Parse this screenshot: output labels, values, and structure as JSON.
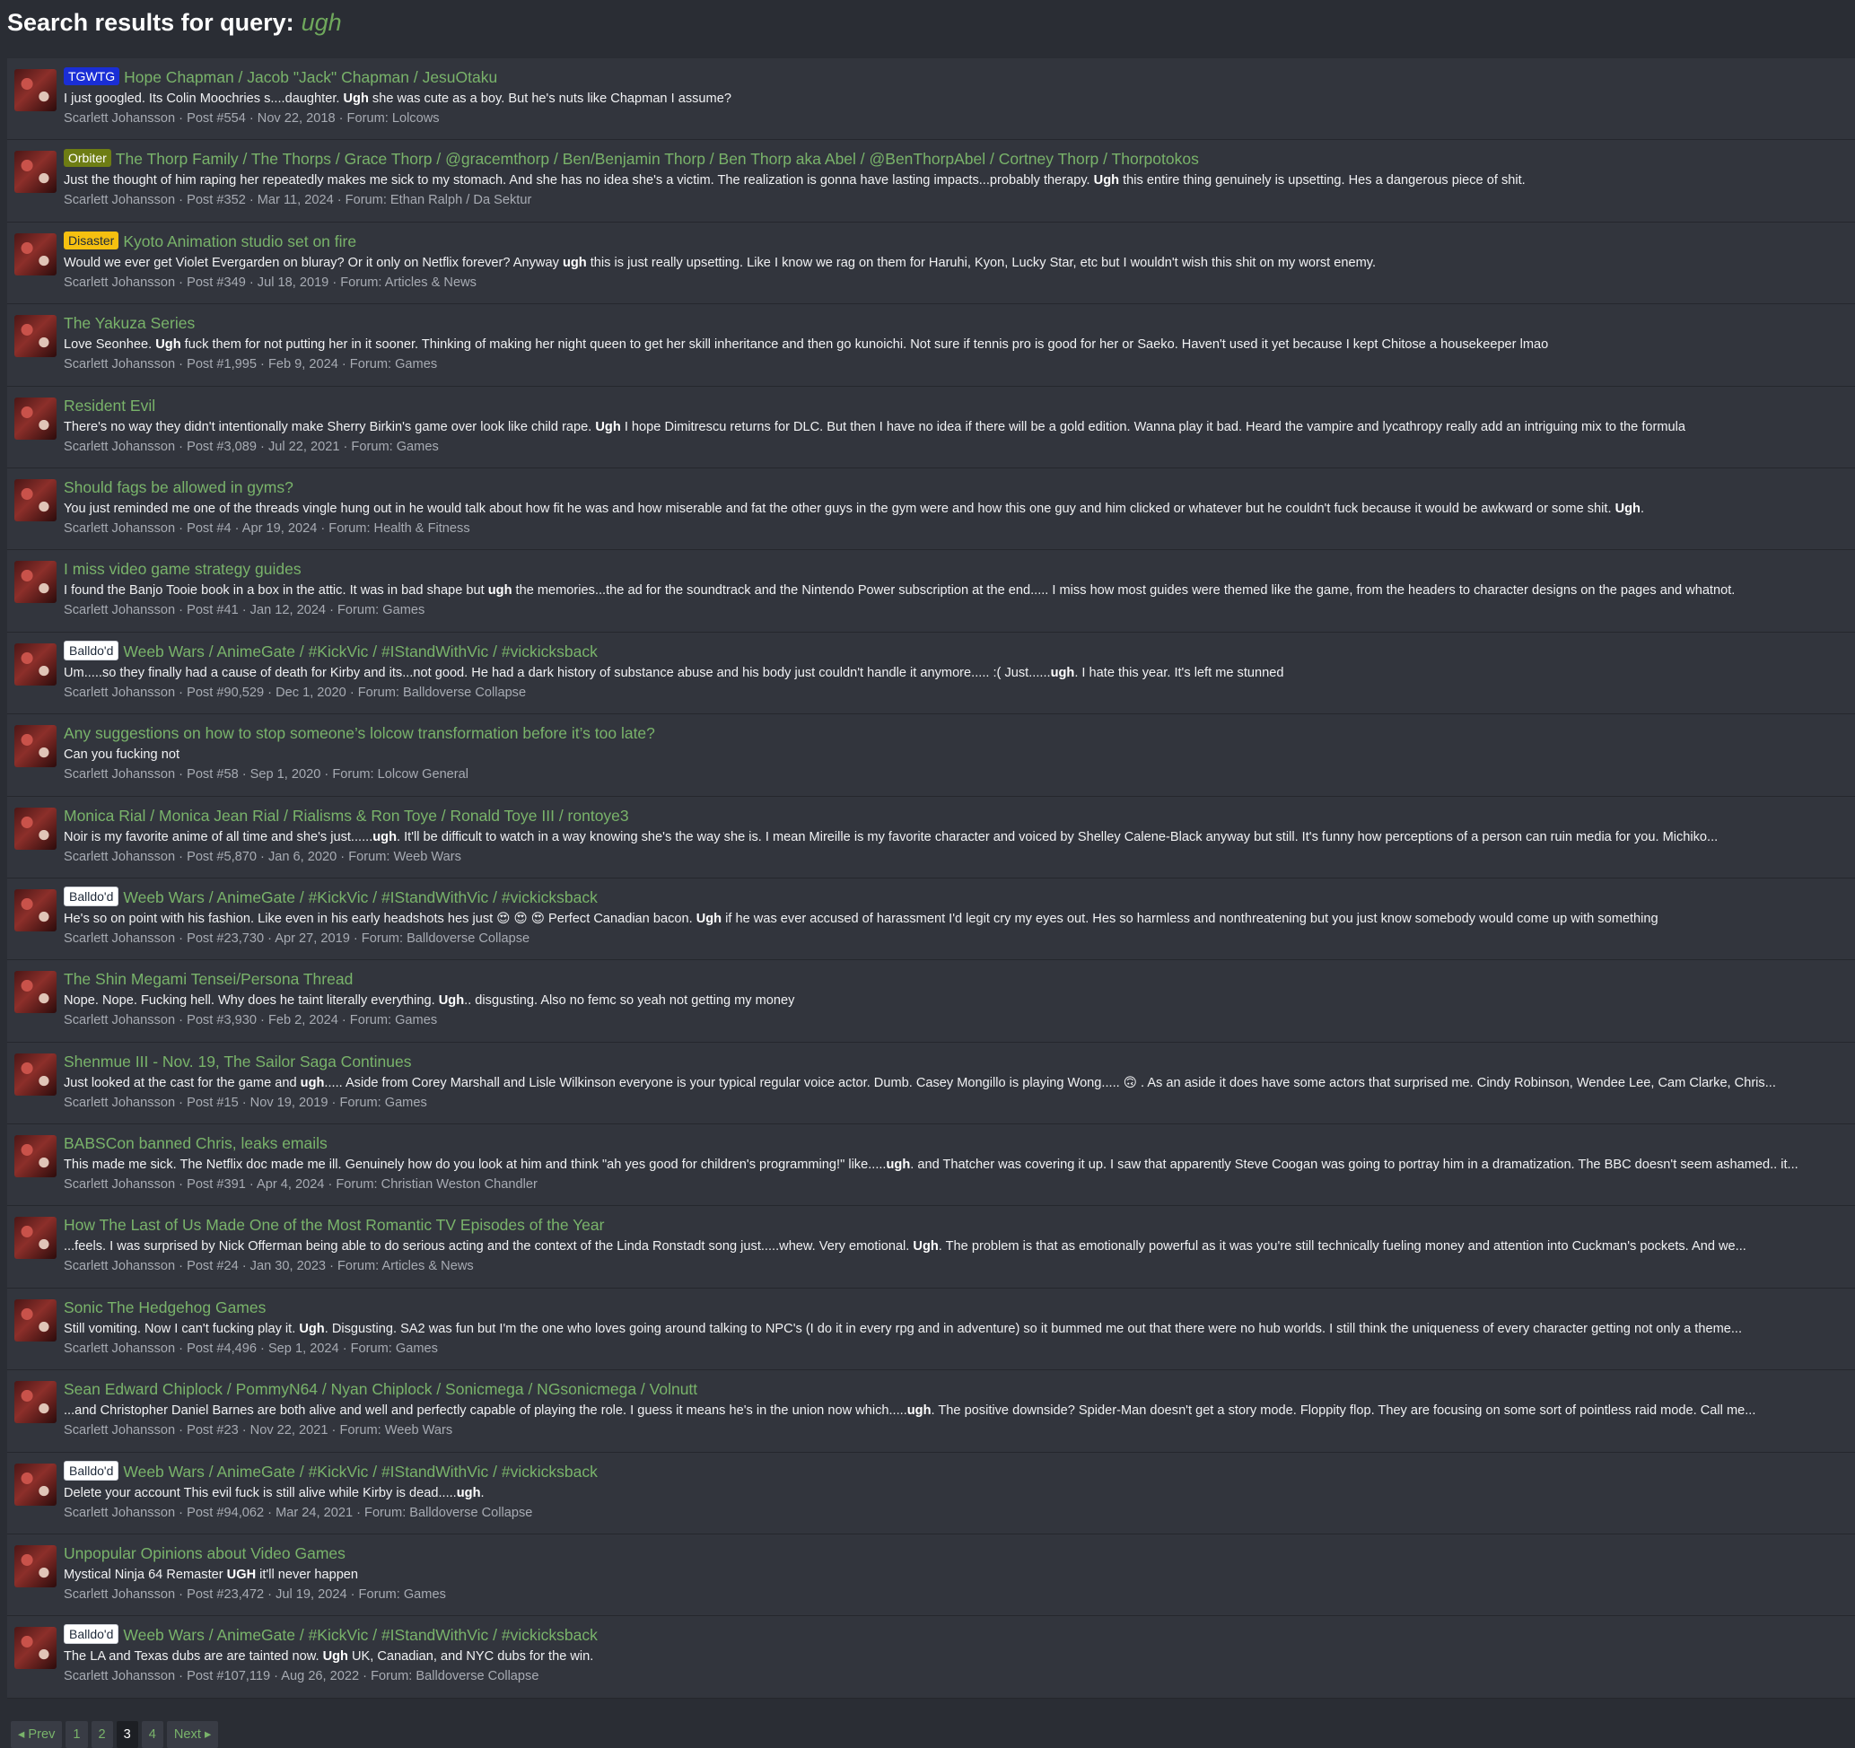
{
  "header": {
    "prefix": "Search results for query:",
    "query": "ugh"
  },
  "results": [
    {
      "label": "TGWTG",
      "label_color": "blue",
      "title": "Hope Chapman / Jacob \"Jack\" Chapman / JesuOtaku",
      "before": "I just googled. Its Colin Moochries s....daughter. ",
      "match": "Ugh",
      "after": " she was cute as a boy. But he's nuts like Chapman I assume?",
      "meta": "Scarlett Johansson · Post #554 · Nov 22, 2018 · Forum: Lolcows"
    },
    {
      "label": "Orbiter",
      "label_color": "olive",
      "title": "The Thorp Family / The Thorps / Grace Thorp / @gracemthorp / Ben/Benjamin Thorp / Ben Thorp aka Abel / @BenThorpAbel / Cortney Thorp / Thorpotokos",
      "before": "Just the thought of him raping her repeatedly makes me sick to my stomach. And she has no idea she's a victim. The realization is gonna have lasting impacts...probably therapy. ",
      "match": "Ugh",
      "after": " this entire thing genuinely is upsetting. Hes a dangerous piece of shit.",
      "meta": "Scarlett Johansson · Post #352 · Mar 11, 2024 · Forum: Ethan Ralph / Da Sektur"
    },
    {
      "label": "Disaster",
      "label_color": "yellow",
      "title": "Kyoto Animation studio set on fire",
      "before": "Would we ever get Violet Evergarden on bluray? Or it only on Netflix forever? Anyway ",
      "match": "ugh",
      "after": " this is just really upsetting. Like I know we rag on them for Haruhi, Kyon, Lucky Star, etc but I wouldn't wish this shit on my worst enemy.",
      "meta": "Scarlett Johansson · Post #349 · Jul 18, 2019 · Forum: Articles & News"
    },
    {
      "label": "",
      "label_color": "",
      "title": "The Yakuza Series",
      "before": "Love Seonhee. ",
      "match": "Ugh",
      "after": " fuck them for not putting her in it sooner. Thinking of making her night queen to get her skill inheritance and then go kunoichi. Not sure if tennis pro is good for her or Saeko. Haven't used it yet because I kept Chitose a housekeeper lmao",
      "meta": "Scarlett Johansson · Post #1,995 · Feb 9, 2024 · Forum: Games"
    },
    {
      "label": "",
      "label_color": "",
      "title": "Resident Evil",
      "before": "There's no way they didn't intentionally make Sherry Birkin's game over look like child rape. ",
      "match": "Ugh",
      "after": " I hope Dimitrescu returns for DLC. But then I have no idea if there will be a gold edition. Wanna play it bad. Heard the vampire and lycathropy really add an intriguing mix to the formula",
      "meta": "Scarlett Johansson · Post #3,089 · Jul 22, 2021 · Forum: Games"
    },
    {
      "label": "",
      "label_color": "",
      "title": "Should fags be allowed in gyms?",
      "before": "You just reminded me one of the threads vingle hung out in he would talk about how fit he was and how miserable and fat the other guys in the gym were and how this one guy and him clicked or whatever but he couldn't fuck because it would be awkward or some shit. ",
      "match": "Ugh",
      "after": ".",
      "meta": "Scarlett Johansson · Post #4 · Apr 19, 2024 · Forum: Health & Fitness"
    },
    {
      "label": "",
      "label_color": "",
      "title": "I miss video game strategy guides",
      "before": "I found the Banjo Tooie book in a box in the attic. It was in bad shape but ",
      "match": "ugh",
      "after": " the memories...the ad for the soundtrack and the Nintendo Power subscription at the end..... I miss how most guides were themed like the game, from the headers to character designs on the pages and whatnot.",
      "meta": "Scarlett Johansson · Post #41 · Jan 12, 2024 · Forum: Games"
    },
    {
      "label": "Balldo'd",
      "label_color": "white",
      "title": "Weeb Wars / AnimeGate / #KickVic / #IStandWithVic / #vickicksback",
      "before": "Um.....so they finally had a cause of death for Kirby and its...not good. He had a dark history of substance abuse and his body just couldn't handle it anymore..... :( Just......",
      "match": "ugh",
      "after": ". I hate this year. It's left me stunned",
      "meta": "Scarlett Johansson · Post #90,529 · Dec 1, 2020 · Forum: Balldoverse Collapse"
    },
    {
      "label": "",
      "label_color": "",
      "title": "Any suggestions on how to stop someone’s lolcow transformation before it’s too late?",
      "before": "Can you fucking not",
      "match": "",
      "after": "",
      "meta": "Scarlett Johansson · Post #58 · Sep 1, 2020 · Forum: Lolcow General"
    },
    {
      "label": "",
      "label_color": "",
      "title": "Monica Rial / Monica Jean Rial / Rialisms & Ron Toye / Ronald Toye III / rontoye3",
      "before": "Noir is my favorite anime of all time and she's just......",
      "match": "ugh",
      "after": ". It'll be difficult to watch in a way knowing she's the way she is. I mean Mireille is my favorite character and voiced by Shelley Calene-Black anyway but still. It's funny how perceptions of a person can ruin media for you. Michiko...",
      "meta": "Scarlett Johansson · Post #5,870 · Jan 6, 2020 · Forum: Weeb Wars"
    },
    {
      "label": "Balldo'd",
      "label_color": "white",
      "title": "Weeb Wars / AnimeGate / #KickVic / #IStandWithVic / #vickicksback",
      "before": "He's so on point with his fashion. Like even in his early headshots hes just 😍 😍 😍 Perfect Canadian bacon. ",
      "match": "Ugh",
      "after": " if he was ever accused of harassment I'd legit cry my eyes out. Hes so harmless and nonthreatening but you just know somebody would come up with something",
      "meta": "Scarlett Johansson · Post #23,730 · Apr 27, 2019 · Forum: Balldoverse Collapse"
    },
    {
      "label": "",
      "label_color": "",
      "title": "The Shin Megami Tensei/Persona Thread",
      "before": "Nope. Nope. Fucking hell. Why does he taint literally everything. ",
      "match": "Ugh",
      "after": ".. disgusting. Also no femc so yeah not getting my money",
      "meta": "Scarlett Johansson · Post #3,930 · Feb 2, 2024 · Forum: Games"
    },
    {
      "label": "",
      "label_color": "",
      "title": "Shenmue III - Nov. 19, The Sailor Saga Continues",
      "before": "Just looked at the cast for the game and ",
      "match": "ugh",
      "after": "..... Aside from Corey Marshall and Lisle Wilkinson everyone is your typical regular voice actor. Dumb. Casey Mongillo is playing Wong..... 🙃 . As an aside it does have some actors that surprised me. Cindy Robinson, Wendee Lee, Cam Clarke, Chris...",
      "meta": "Scarlett Johansson · Post #15 · Nov 19, 2019 · Forum: Games"
    },
    {
      "label": "",
      "label_color": "",
      "title": "BABSCon banned Chris, leaks emails",
      "before": "This made me sick. The Netflix doc made me ill. Genuinely how do you look at him and think \"ah yes good for children's programming!\" like.....",
      "match": "ugh",
      "after": ". and Thatcher was covering it up. I saw that apparently Steve Coogan was going to portray him in a dramatization. The BBC doesn't seem ashamed.. it...",
      "meta": "Scarlett Johansson · Post #391 · Apr 4, 2024 · Forum: Christian Weston Chandler"
    },
    {
      "label": "",
      "label_color": "",
      "title": "How The Last of Us Made One of the Most Romantic TV Episodes of the Year",
      "before": "...feels. I was surprised by Nick Offerman being able to do serious acting and the context of the Linda Ronstadt song just.....whew. Very emotional. ",
      "match": "Ugh",
      "after": ". The problem is that as emotionally powerful as it was you're still technically fueling money and attention into Cuckman's pockets. And we...",
      "meta": "Scarlett Johansson · Post #24 · Jan 30, 2023 · Forum: Articles & News"
    },
    {
      "label": "",
      "label_color": "",
      "title": "Sonic The Hedgehog Games",
      "before": "Still vomiting. Now I can't fucking play it. ",
      "match": "Ugh",
      "after": ". Disgusting. SA2 was fun but I'm the one who loves going around talking to NPC's (I do it in every rpg and in adventure) so it bummed me out that there were no hub worlds. I still think the uniqueness of every character getting not only a theme...",
      "meta": "Scarlett Johansson · Post #4,496 · Sep 1, 2024 · Forum: Games"
    },
    {
      "label": "",
      "label_color": "",
      "title": "Sean Edward Chiplock / PommyN64 / Nyan Chiplock / Sonicmega / NGsonicmega / Volnutt",
      "before": "...and Christopher Daniel Barnes are both alive and well and perfectly capable of playing the role. I guess it means he's in the union now which.....",
      "match": "ugh",
      "after": ". The positive downside? Spider-Man doesn't get a story mode. Floppity flop. They are focusing on some sort of pointless raid mode. Call me...",
      "meta": "Scarlett Johansson · Post #23 · Nov 22, 2021 · Forum: Weeb Wars"
    },
    {
      "label": "Balldo'd",
      "label_color": "white",
      "title": "Weeb Wars / AnimeGate / #KickVic / #IStandWithVic / #vickicksback",
      "before": "Delete your account This evil fuck is still alive while Kirby is dead.....",
      "match": "ugh",
      "after": ".",
      "meta": "Scarlett Johansson · Post #94,062 · Mar 24, 2021 · Forum: Balldoverse Collapse"
    },
    {
      "label": "",
      "label_color": "",
      "title": "Unpopular Opinions about Video Games",
      "before": "Mystical Ninja 64 Remaster ",
      "match": "UGH",
      "after": " it'll never happen",
      "meta": "Scarlett Johansson · Post #23,472 · Jul 19, 2024 · Forum: Games"
    },
    {
      "label": "Balldo'd",
      "label_color": "white",
      "title": "Weeb Wars / AnimeGate / #KickVic / #IStandWithVic / #vickicksback",
      "before": "The LA and Texas dubs are are tainted now. ",
      "match": "Ugh",
      "after": " UK, Canadian, and NYC dubs for the win.",
      "meta": "Scarlett Johansson · Post #107,119 · Aug 26, 2022 · Forum: Balldoverse Collapse"
    }
  ],
  "pagination": {
    "prev": "◂ Prev",
    "pages": [
      "1",
      "2",
      "3",
      "4"
    ],
    "current": "3",
    "next": "Next ▸"
  }
}
